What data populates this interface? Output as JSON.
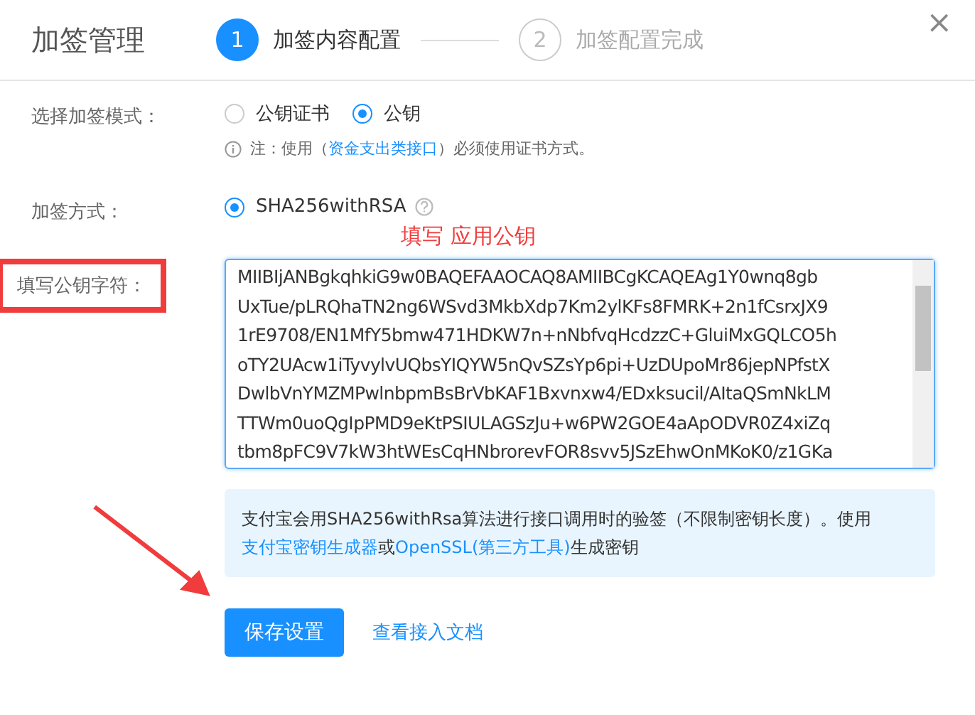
{
  "dialog": {
    "title": "加签管理",
    "close": "×"
  },
  "steps": [
    {
      "number": "1",
      "label": "加签内容配置",
      "selected": true
    },
    {
      "number": "2",
      "label": "加签配置完成",
      "selected": false
    }
  ],
  "mode_row": {
    "label": "选择加签模式：",
    "options": [
      {
        "label": "公钥证书",
        "selected": false
      },
      {
        "label": "公钥",
        "selected": true
      }
    ],
    "note": {
      "prefix": "注：使用（",
      "link": "资金支出类接口",
      "suffix": "）必须使用证书方式。"
    }
  },
  "method_row": {
    "label": "加签方式：",
    "options": [
      {
        "label": "SHA256withRSA",
        "selected": true
      }
    ],
    "annotation": "填写 应用公钥"
  },
  "key_row": {
    "label": "填写公钥字符：",
    "highlighted": true,
    "lines": [
      "MIIBIjANBgkqhkiG9w0BAQEFAAOCAQ8AMIIBCgKCAQEAg1Y0wnq8gb",
      "UxTue/pLRQhaTN2ng6WSvd3MkbXdp7Km2ylKFs8FMRK+2n1fCsrxJX9",
      "1rE9708/EN1MfY5bmw471HDKW7n+nNbfvqHcdzzC+GluiMxGQLCO5h",
      "oTY2UAcw1iTyvylvUQbsYIQYW5nQvSZsYp6pi+UzDUpoMr86jepNPfstX",
      "DwlbVnYMZMPwlnbpmBsBrVbKAF1Bxvnxw4/EDxksucil/AItaQSmNkLM",
      "TTWm0uoQgIpPMD9eKtPSIULAGSzJu+w6PW2GOE4aApODVR0Z4xiZq",
      "tbm8pFC9V7kW3htWEsCqHNbrorevFOR8svv5JSzEhwOnMKoK0/z1GKa"
    ]
  },
  "tip": {
    "parts": [
      {
        "kind": "text",
        "text": "支付宝会用SHA256withRsa算法进行接口调用时的验签（不限制密钥长度）。使用"
      },
      {
        "kind": "link",
        "text": "支付宝密钥生成器"
      },
      {
        "kind": "text",
        "text": "或"
      },
      {
        "kind": "link",
        "text": "OpenSSL(第三方工具)"
      },
      {
        "kind": "text",
        "text": "生成密钥"
      }
    ]
  },
  "actions": {
    "save": "保存设置",
    "docs": "查看接入文档"
  }
}
